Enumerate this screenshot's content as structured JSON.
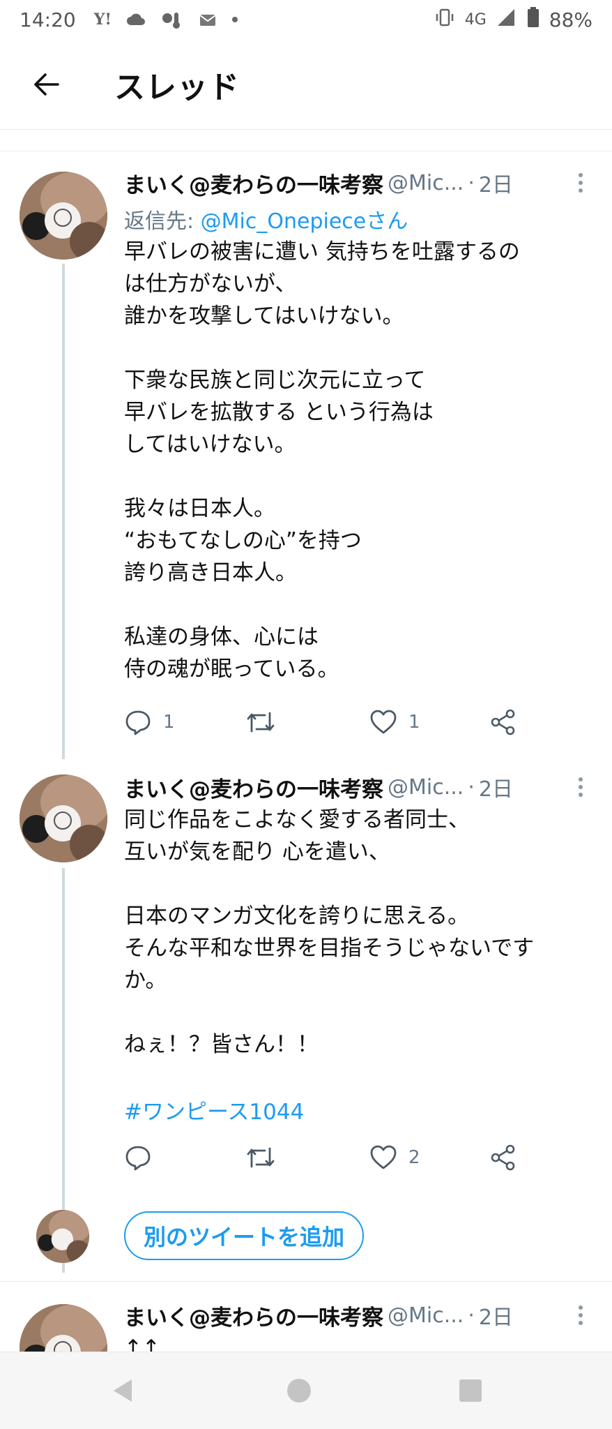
{
  "status_bar": {
    "time": "14:20",
    "network": "4G",
    "battery": "88%",
    "notification_icons": [
      "yahoo-icon",
      "weather-icon",
      "cloud-icon",
      "mail-icon",
      "dot-icon"
    ]
  },
  "header": {
    "title": "スレッド"
  },
  "tweets": [
    {
      "author": "まいく@麦わらの一味考察",
      "handle": "@Mic...",
      "separator": "·",
      "time": "2日",
      "reply_prefix": "返信先: ",
      "reply_handle": "@Mic_Onepieceさん",
      "body": "早バレの被害に遭い 気持ちを吐露するの\nは仕方がないが、\n誰かを攻撃してはいけない。\n\n下衆な民族と同じ次元に立って\n早バレを拡散する という行為は\nしてはいけない。\n\n我々は日本人。\n“おもてなしの心”を持つ\n誇り高き日本人。\n\n私達の身体、心には\n侍の魂が眠っている。",
      "reply_count": "1",
      "like_count": "1"
    },
    {
      "author": "まいく@麦わらの一味考察",
      "handle": "@Mic...",
      "separator": "·",
      "time": "2日",
      "body": "同じ作品をこよなく愛する者同士、\n互いが気を配り 心を遣い、\n\n日本のマンガ文化を誇りに思える。\nそんな平和な世界を目指そうじゃないです\nか。\n\nねぇ！？皆さん！！",
      "hashtag": "#ワンピース1044",
      "reply_count": "",
      "like_count": "2"
    },
    {
      "author": "まいく@麦わらの一味考察",
      "handle": "@Mic...",
      "separator": "·",
      "time": "2日",
      "body": "↑↑"
    }
  ],
  "add_tweet_label": "別のツイートを追加",
  "colors": {
    "accent": "#1d9bf0",
    "secondary_text": "#657786",
    "thread_line": "#cfd9de"
  }
}
